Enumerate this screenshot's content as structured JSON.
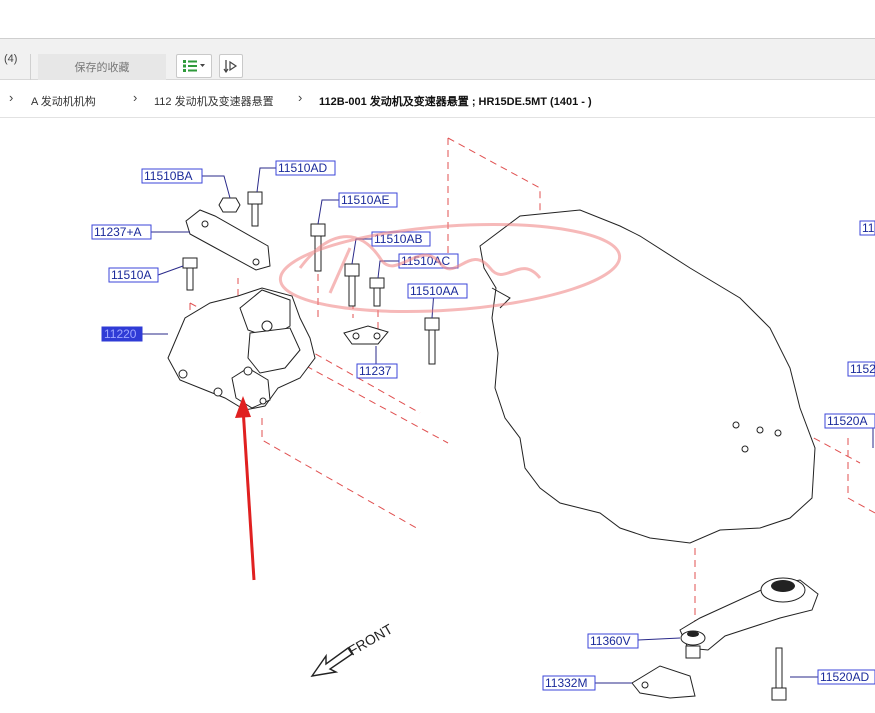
{
  "toolbar": {
    "tab_count": "(4)",
    "saved_tab_label": "保存的收藏",
    "list_view_icon": "list-icon",
    "sort_icon": "sort-icon"
  },
  "breadcrumb": {
    "items": [
      "A 发动机机构",
      "112 发动机及变速器悬置",
      "112B-001 发动机及变速器悬置 ; HR15DE.5MT (1401 - )"
    ]
  },
  "diagram": {
    "labels": {
      "l11510BA": "11510BA",
      "l11510AD": "11510AD",
      "l11510AE": "11510AE",
      "l11237A": "11237+A",
      "l11510AB": "11510AB",
      "l11510AC": "11510AC",
      "l11510A": "11510A",
      "l11510AA": "11510AA",
      "l11220": "11220",
      "l11237": "11237",
      "l11520A": "11520A",
      "l11360V": "11360V",
      "l11332M": "11332M",
      "l11520AD": "11520AD",
      "cut1": "11",
      "cut2": "1152"
    },
    "front_label": "FRONT",
    "selected_part": "11220",
    "colors": {
      "label_text": "#1a2a9a",
      "label_border": "#3b46d8",
      "selected_fill": "#2f3bd6",
      "dashed_lines": "#e05050",
      "arrow": "#e02020",
      "watermark": "#f08080"
    }
  }
}
